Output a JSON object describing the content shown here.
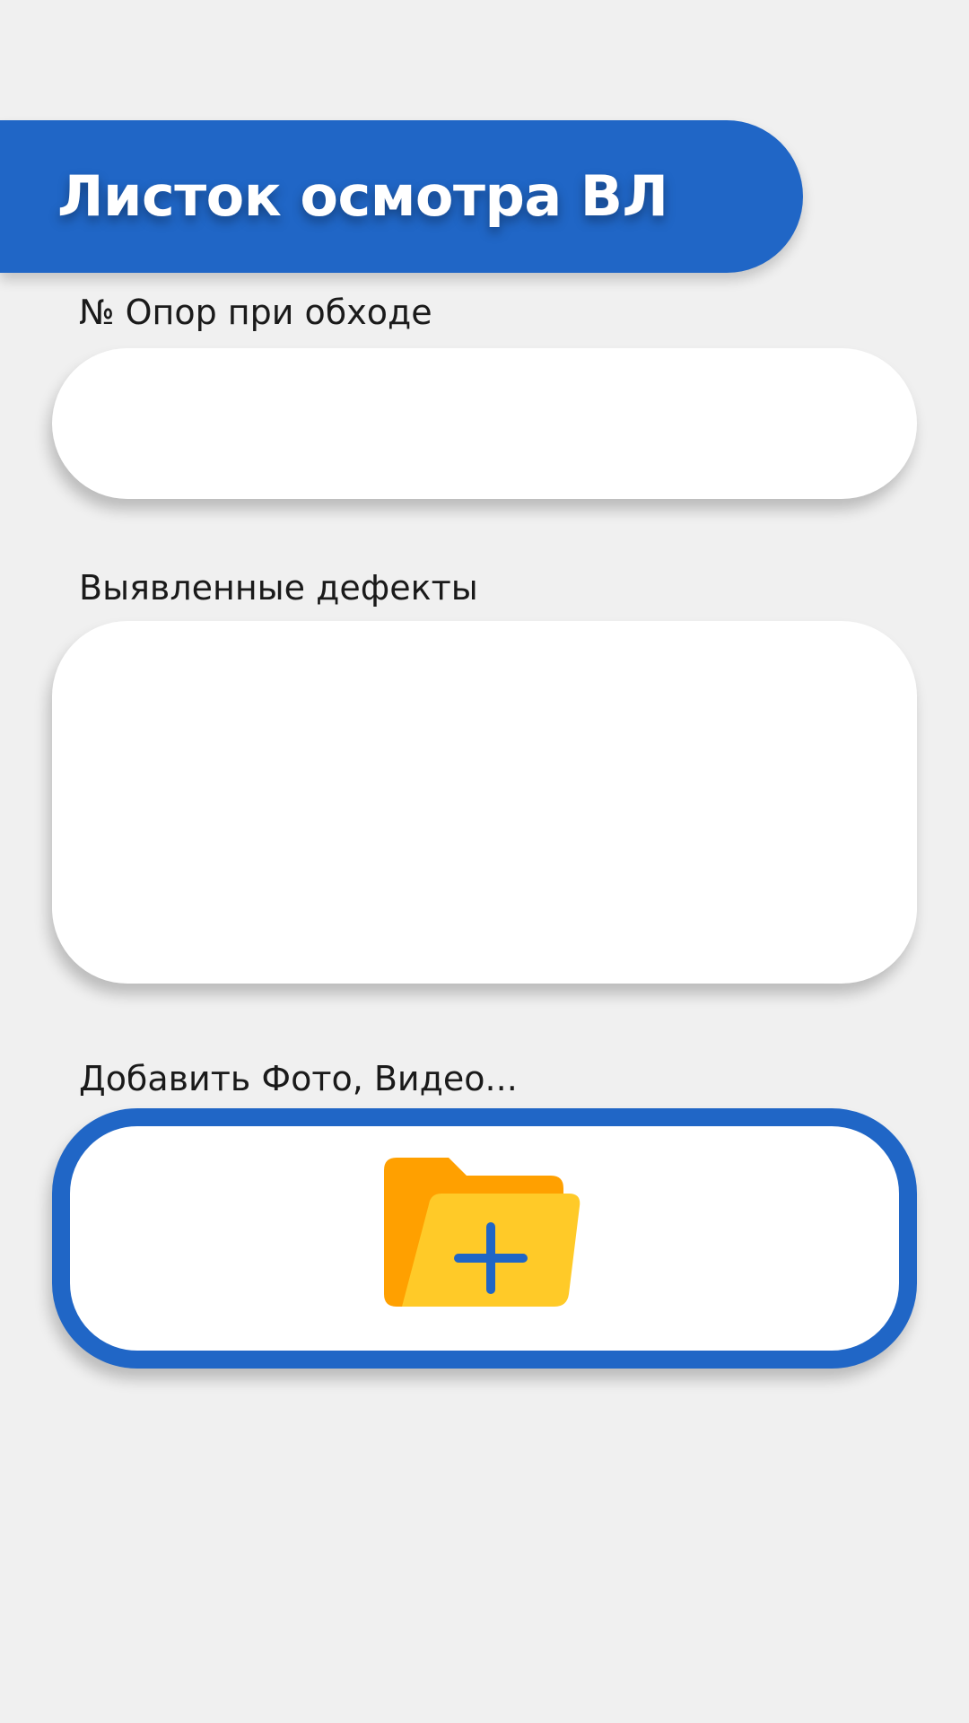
{
  "header": {
    "title": "Листок осмотра ВЛ"
  },
  "form": {
    "supports_label": "№ Опор при обходе",
    "supports_value": "",
    "defects_label": "Выявленные дефекты",
    "defects_value": "",
    "media_label": "Добавить Фото, Видео..."
  },
  "icons": {
    "media_button": "folder-add-icon"
  },
  "colors": {
    "accent": "#2066c6",
    "background": "#f0f0f0",
    "folder_back": "#ffa000",
    "folder_front": "#ffca28"
  }
}
